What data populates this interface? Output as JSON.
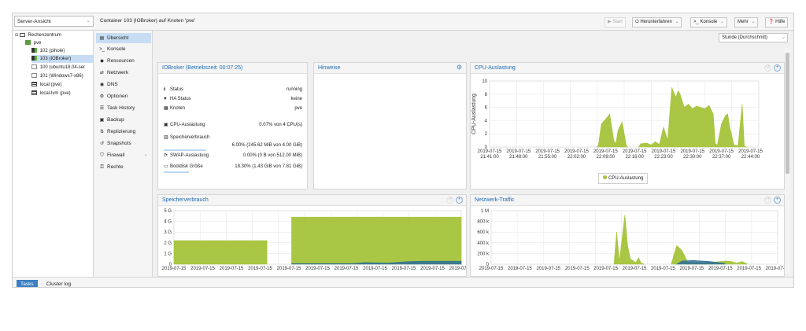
{
  "topbar": {
    "view_select": "Server-Ansicht",
    "title": "Container 103 (IOBroker) auf Knoten 'pve'",
    "buttons": {
      "start": "Start",
      "shutdown": "Herunterfahren",
      "console": "Konsole",
      "more": "Mehr",
      "help": "Hilfe"
    }
  },
  "tree": {
    "items": [
      {
        "label": "Rechenzentrum",
        "icon": "datacenter-icon"
      },
      {
        "label": "pve",
        "icon": "node-icon"
      },
      {
        "label": "102 (pihole)",
        "icon": "container-running-icon"
      },
      {
        "label": "103 (IOBroker)",
        "icon": "container-running-icon"
      },
      {
        "label": "100 (ubuntu18.04-ser",
        "icon": "vm-stopped-icon"
      },
      {
        "label": "101 (Windows7-x86)",
        "icon": "vm-stopped-icon"
      },
      {
        "label": "local (pve)",
        "icon": "storage-icon"
      },
      {
        "label": "local-lvm (pve)",
        "icon": "storage-icon"
      }
    ]
  },
  "menu": {
    "items": [
      {
        "label": "Übersicht",
        "icon": "book-icon"
      },
      {
        "label": "Konsole",
        "icon": "terminal-icon"
      },
      {
        "label": "Ressourcen",
        "icon": "cube-icon"
      },
      {
        "label": "Netzwerk",
        "icon": "network-icon"
      },
      {
        "label": "DNS",
        "icon": "globe-icon"
      },
      {
        "label": "Optionen",
        "icon": "gear-icon"
      },
      {
        "label": "Task History",
        "icon": "list-icon"
      },
      {
        "label": "Backup",
        "icon": "floppy-icon"
      },
      {
        "label": "Replizierung",
        "icon": "retweet-icon"
      },
      {
        "label": "Snapshots",
        "icon": "history-icon"
      },
      {
        "label": "Firewall",
        "icon": "shield-icon"
      },
      {
        "label": "Rechte",
        "icon": "unlock-icon"
      }
    ]
  },
  "timeframe": "Stunde (Durchschnitt)",
  "status_panel": {
    "title": "IOBroker (Betriebszeit: 00:07:25)",
    "rows": {
      "status": {
        "label": "Status",
        "value": "running"
      },
      "ha": {
        "label": "HA Status",
        "value": "keine"
      },
      "node": {
        "label": "Knoten",
        "value": "pve"
      },
      "cpu": {
        "label": "CPU-Auslastung",
        "value": "0.07% von 4 CPU(s)",
        "fraction": 0.0007
      },
      "mem": {
        "label": "Speicherverbrauch",
        "value": "6.00% (245.62 MiB von 4.00 GiB)",
        "fraction": 0.06
      },
      "swap": {
        "label": "SWAP-Auslastung",
        "value": "0.00% (0 B von 512.00 MiB)",
        "fraction": 0.0
      },
      "disk": {
        "label": "Bootdisk Größe",
        "value": "18.30% (1.43 GiB von 7.81 GiB)",
        "fraction": 0.183
      }
    }
  },
  "notes_panel": {
    "title": "Hinweise"
  },
  "colors": {
    "series_green": "#a4c43a",
    "series_blue": "#2f6e96",
    "accent": "#3c7fc2"
  },
  "chart_data": [
    {
      "type": "area",
      "title": "CPU-Auslastung",
      "ylabel": "CPU-Auslastung",
      "ylim": [
        0,
        10
      ],
      "yticks": [
        0,
        2,
        4,
        6,
        8,
        10
      ],
      "xlim": [
        0,
        65
      ],
      "x_ticks": [
        {
          "date": "2019-07-15",
          "time": "21:41:00",
          "x": 0
        },
        {
          "date": "2019-07-15",
          "time": "21:48:00",
          "x": 7
        },
        {
          "date": "2019-07-15",
          "time": "21:55:00",
          "x": 14
        },
        {
          "date": "2019-07-15",
          "time": "22:02:00",
          "x": 21
        },
        {
          "date": "2019-07-15",
          "time": "22:09:00",
          "x": 28
        },
        {
          "date": "2019-07-15",
          "time": "22:16:00",
          "x": 35
        },
        {
          "date": "2019-07-15",
          "time": "22:23:00",
          "x": 42
        },
        {
          "date": "2019-07-15",
          "time": "22:30:00",
          "x": 49
        },
        {
          "date": "2019-07-15",
          "time": "22:37:00",
          "x": 56
        },
        {
          "date": "2019-07-15",
          "time": "22:44:00",
          "x": 63
        }
      ],
      "legend": [
        "CPU-Auslastung"
      ],
      "series": [
        {
          "name": "CPU-Auslastung",
          "segments": [
            [
              [
                26,
                0
              ],
              [
                26.3,
                0.4
              ],
              [
                27,
                3.5
              ],
              [
                28,
                4.2
              ],
              [
                29,
                5.0
              ],
              [
                30,
                1.0
              ],
              [
                30.5,
                0.5
              ],
              [
                31,
                2.5
              ],
              [
                32,
                3.8
              ],
              [
                33,
                0.3
              ],
              [
                33.3,
                0
              ]
            ],
            [
              [
                36,
                0
              ],
              [
                36.5,
                0.5
              ],
              [
                38,
                0.6
              ],
              [
                39,
                0.3
              ],
              [
                40,
                0.8
              ],
              [
                41,
                0.4
              ],
              [
                42,
                3.0
              ],
              [
                43,
                1.0
              ],
              [
                44,
                9.0
              ],
              [
                45,
                7.5
              ],
              [
                45.5,
                8.5
              ],
              [
                46,
                8.0
              ],
              [
                47,
                6.0
              ],
              [
                48,
                6.5
              ],
              [
                49,
                5.8
              ],
              [
                50,
                6.2
              ],
              [
                51,
                6.0
              ],
              [
                52,
                5.8
              ],
              [
                53,
                6.3
              ],
              [
                54,
                5.0
              ],
              [
                54.5,
                0.5
              ],
              [
                55,
                0.3
              ],
              [
                56,
                3.5
              ],
              [
                57,
                4.8
              ],
              [
                57.5,
                5.0
              ],
              [
                58,
                3.0
              ],
              [
                59,
                0.3
              ],
              [
                60,
                0.2
              ],
              [
                61,
                6.5
              ],
              [
                61.5,
                0.2
              ],
              [
                62,
                0
              ]
            ]
          ]
        }
      ]
    },
    {
      "type": "area",
      "title": "Speicherverbrauch",
      "ylim": [
        0,
        5
      ],
      "yticks": [
        0,
        1,
        2,
        3,
        4,
        5
      ],
      "ytick_labels": [
        "0",
        "1 G",
        "2 G",
        "3 G",
        "4 G",
        "5 G"
      ],
      "xlim": [
        0,
        10.5
      ],
      "x_tick_labels": [
        "2019-07-15",
        "2019-07-15",
        "2019-07-15",
        "2019-07-15",
        "2019-07-15",
        "2019-07-15",
        "2019-07-15",
        "2019-07-15",
        "2019-07-15",
        "2019-07-15",
        "2019-07-15"
      ],
      "series": [
        {
          "name": "",
          "color": "green",
          "segments": [
            [
              [
                0,
                2.2
              ],
              [
                3.4,
                2.2
              ]
            ],
            [
              [
                4.3,
                4.4
              ],
              [
                10.5,
                4.4
              ]
            ]
          ]
        },
        {
          "name": "",
          "color": "blue",
          "segments": [
            [
              [
                4.3,
                0.05
              ],
              [
                6.5,
                0.05
              ],
              [
                7,
                0.15
              ],
              [
                7.8,
                0.1
              ],
              [
                8.6,
                0.25
              ],
              [
                9.2,
                0.28
              ],
              [
                10.5,
                0.28
              ]
            ]
          ]
        }
      ]
    },
    {
      "type": "area",
      "title": "Netzwerk-Traffic",
      "ylim": [
        0,
        1000
      ],
      "yticks": [
        0,
        200,
        400,
        600,
        800,
        1000
      ],
      "ytick_labels": [
        "0",
        "200 k",
        "400 k",
        "600 k",
        "800 k",
        "1 M"
      ],
      "xlim": [
        0,
        10.5
      ],
      "x_tick_labels": [
        "2019-07-15",
        "2019-07-15",
        "2019-07-15",
        "2019-07-15",
        "2019-07-15",
        "2019-07-15",
        "2019-07-15",
        "2019-07-15",
        "2019-07-15",
        "2019-07-15",
        "2019-07-15"
      ],
      "series": [
        {
          "name": "",
          "color": "green",
          "segments": [
            [
              [
                4.5,
                0
              ],
              [
                4.6,
                600
              ],
              [
                4.7,
                50
              ],
              [
                4.9,
                920
              ],
              [
                5.0,
                350
              ],
              [
                5.1,
                100
              ],
              [
                5.3,
                30
              ],
              [
                5.4,
                120
              ],
              [
                5.5,
                20
              ],
              [
                5.6,
                0
              ]
            ],
            [
              [
                6.6,
                0
              ],
              [
                6.8,
                350
              ],
              [
                7.0,
                250
              ],
              [
                7.2,
                40
              ],
              [
                7.5,
                30
              ],
              [
                7.8,
                30
              ],
              [
                8.2,
                40
              ],
              [
                8.6,
                60
              ],
              [
                8.8,
                50
              ],
              [
                9.0,
                20
              ],
              [
                9.2,
                50
              ],
              [
                9.4,
                0
              ]
            ]
          ]
        },
        {
          "name": "",
          "color": "blue",
          "segments": [
            [
              [
                6.8,
                0
              ],
              [
                7.0,
                60
              ],
              [
                7.4,
                70
              ],
              [
                8.0,
                50
              ],
              [
                8.5,
                20
              ],
              [
                8.6,
                0
              ]
            ]
          ]
        }
      ]
    }
  ],
  "bottom_tabs": [
    "Tasks",
    "Cluster log"
  ]
}
